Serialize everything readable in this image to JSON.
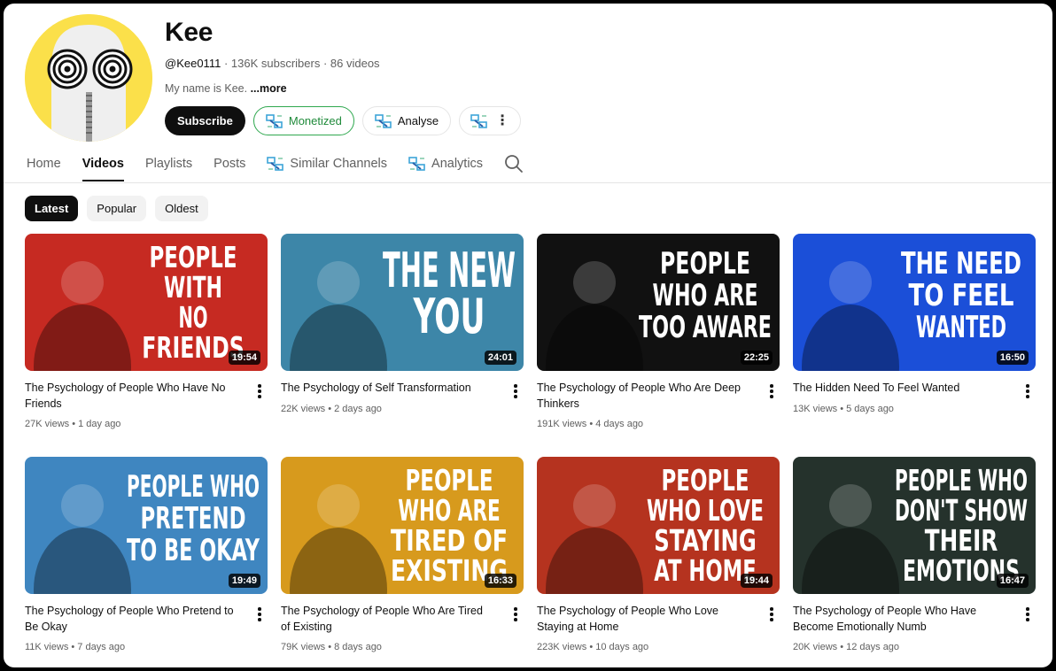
{
  "channel": {
    "name": "Kee",
    "handle": "@Kee0111",
    "subscribers": "136K subscribers",
    "videos_count": "86 videos",
    "separator": " · ",
    "description": "My name is Kee. ",
    "more_label": "...more"
  },
  "actions": {
    "subscribe": "Subscribe",
    "monetized": "Monetized",
    "analyse": "Analyse"
  },
  "tabs": [
    {
      "label": "Home",
      "active": false
    },
    {
      "label": "Videos",
      "active": true
    },
    {
      "label": "Playlists",
      "active": false
    },
    {
      "label": "Posts",
      "active": false
    },
    {
      "label": "Similar Channels",
      "active": false
    },
    {
      "label": "Analytics",
      "active": false
    }
  ],
  "chips": [
    {
      "label": "Latest",
      "active": true
    },
    {
      "label": "Popular",
      "active": false
    },
    {
      "label": "Oldest",
      "active": false
    }
  ],
  "colors": {
    "monetized": "#1f8a3a",
    "avatar_bg": "#fbe04a",
    "extension_icon": "#3da5d9"
  },
  "videos": [
    {
      "title": "The Psychology of People Who Have No Friends",
      "views": "27K views",
      "age": "1 day ago",
      "duration": "19:54",
      "thumb_lines": [
        "PEOPLE",
        "WITH",
        "NO",
        "FRIENDS"
      ],
      "thumb_bg": "#c62a22"
    },
    {
      "title": "The Psychology of Self Transformation",
      "views": "22K views",
      "age": "2 days ago",
      "duration": "24:01",
      "thumb_lines": [
        "THE NEW",
        "YOU"
      ],
      "thumb_bg": "#3d86a8"
    },
    {
      "title": "The Psychology of People Who Are Deep Thinkers",
      "views": "191K views",
      "age": "4 days ago",
      "duration": "22:25",
      "thumb_lines": [
        "PEOPLE",
        "WHO ARE",
        "TOO AWARE"
      ],
      "thumb_bg": "#111111"
    },
    {
      "title": "The Hidden Need To Feel Wanted",
      "views": "13K views",
      "age": "5 days ago",
      "duration": "16:50",
      "thumb_lines": [
        "THE NEED",
        "TO FEEL",
        "WANTED"
      ],
      "thumb_bg": "#1b4fd8"
    },
    {
      "title": "The Psychology of People Who Pretend to Be Okay",
      "views": "11K views",
      "age": "7 days ago",
      "duration": "19:49",
      "thumb_lines": [
        "PEOPLE WHO",
        "PRETEND",
        "TO BE OKAY"
      ],
      "thumb_bg": "#3f86c0"
    },
    {
      "title": "The Psychology of People Who Are Tired of Existing",
      "views": "79K views",
      "age": "8 days ago",
      "duration": "16:33",
      "thumb_lines": [
        "PEOPLE",
        "WHO ARE",
        "TIRED OF",
        "EXISTING"
      ],
      "thumb_bg": "#d79a1d"
    },
    {
      "title": "The Psychology of People Who Love Staying at Home",
      "views": "223K views",
      "age": "10 days ago",
      "duration": "19:44",
      "thumb_lines": [
        "PEOPLE",
        "WHO LOVE",
        "STAYING",
        "AT HOME"
      ],
      "thumb_bg": "#b5331f"
    },
    {
      "title": "The Psychology of People Who Have Become Emotionally Numb",
      "views": "20K views",
      "age": "12 days ago",
      "duration": "16:47",
      "thumb_lines": [
        "PEOPLE WHO",
        "DON'T SHOW",
        "THEIR",
        "EMOTIONS"
      ],
      "thumb_bg": "#25322c"
    }
  ]
}
